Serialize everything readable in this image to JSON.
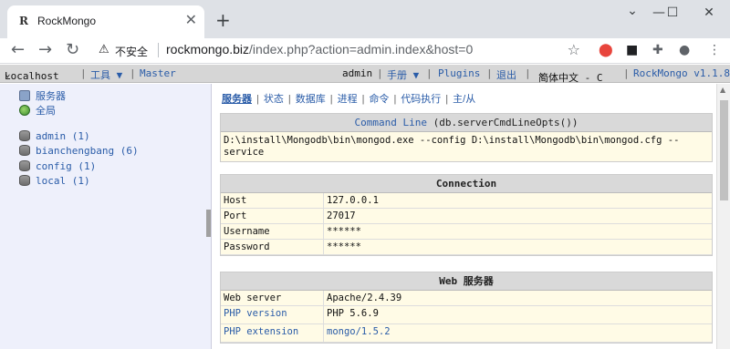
{
  "browser": {
    "tab": {
      "favicon": "R",
      "title": "RockMongo"
    },
    "insecure_label": "不安全",
    "url_host": "rockmongo.biz",
    "url_path": "/index.php?action=admin.index&host=0"
  },
  "topbar": {
    "host": "Localhost",
    "tools": "工具 ▼",
    "master": "Master",
    "user": "admin",
    "manual": "手册 ▼",
    "plugins": "Plugins",
    "logout": "退出",
    "language": "简体中文 - C",
    "version": "RockMongo v1.1.8"
  },
  "sidebar": {
    "server": "服务器",
    "overview": "全局",
    "databases": [
      {
        "label": "admin (1)"
      },
      {
        "label": "bianchengbang (6)"
      },
      {
        "label": "config (1)"
      },
      {
        "label": "local (1)"
      }
    ]
  },
  "subnav": [
    "服务器",
    "状态",
    "数据库",
    "进程",
    "命令",
    "代码执行",
    "主/从"
  ],
  "command_line": {
    "title_link": "Command Line",
    "title_rest": "(db.serverCmdLineOpts())",
    "value_line1": "D:\\install\\Mongodb\\bin\\mongod.exe --config D:\\install\\Mongodb\\bin\\mongod.cfg --",
    "value_line2": "service"
  },
  "connection": {
    "title": "Connection",
    "rows": [
      {
        "key": "Host",
        "value": "127.0.0.1"
      },
      {
        "key": "Port",
        "value": "27017"
      },
      {
        "key": "Username",
        "value": "******"
      },
      {
        "key": "Password",
        "value": "******"
      }
    ]
  },
  "web_server": {
    "title": "Web 服务器",
    "rows": [
      {
        "key": "Web server",
        "value": "Apache/2.4.39"
      },
      {
        "key": "PHP version",
        "value": "PHP 5.6.9"
      },
      {
        "key": "PHP extension",
        "value": "mongo/1.5.2"
      }
    ]
  },
  "colors": {
    "link": "#2a5ca8",
    "row_bg": "#fffbe6",
    "header_bg": "#d9d9d9",
    "sidebar_bg": "#eef0fb"
  }
}
